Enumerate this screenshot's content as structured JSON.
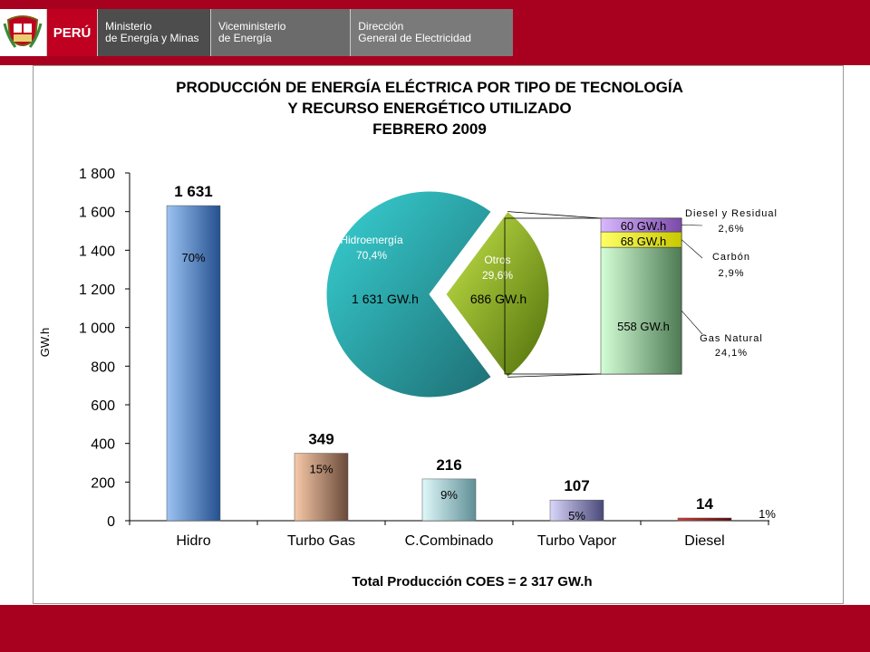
{
  "header": {
    "peru": "PERÚ",
    "ministry_l1": "Ministerio",
    "ministry_l2": "de Energía y Minas",
    "vice_l1": "Viceministerio",
    "vice_l2": "de Energía",
    "dir_l1": "Dirección",
    "dir_l2": "General de Electricidad"
  },
  "colors": {
    "brand": "#a8001f",
    "peru_red": "#c00020"
  },
  "chart_data": [
    {
      "type": "bar",
      "title": [
        "PRODUCCIÓN DE ENERGÍA ELÉCTRICA POR TIPO DE TECNOLOGÍA",
        "Y RECURSO ENERGÉTICO UTILIZADO",
        "FEBRERO 2009"
      ],
      "ylabel": "GW.h",
      "ylim": [
        0,
        1800
      ],
      "yticks": [
        0,
        200,
        400,
        600,
        800,
        1000,
        1200,
        1400,
        1600,
        1800
      ],
      "ytick_labels": [
        "0",
        "200",
        "400",
        "600",
        "800",
        "1 000",
        "1 200",
        "1 400",
        "1 600",
        "1 800"
      ],
      "categories": [
        "Hidro",
        "Turbo Gas",
        "C.Combinado",
        "Turbo Vapor",
        "Diesel"
      ],
      "values": [
        1631,
        349,
        216,
        107,
        14
      ],
      "value_labels": [
        "1 631",
        "349",
        "216",
        "107",
        "14"
      ],
      "percent_labels": [
        "70%",
        "15%",
        "9%",
        "5%",
        "1%"
      ],
      "colors": [
        "#4f86c6",
        "#d9a27b",
        "#a8dfe6",
        "#a9a6dd",
        "#8b1a1a"
      ],
      "footer": "Total Producción COES = 2 317 GW.h"
    },
    {
      "type": "pie",
      "slices": [
        {
          "label": "Hidroenergía",
          "percent_label": "70,4%",
          "value_label": "1 631 GW.h",
          "value": 70.4,
          "color": "#2bb5b8"
        },
        {
          "label": "Otros",
          "percent_label": "29,6%",
          "value_label": "686 GW.h",
          "value": 29.6,
          "color": "#8db51c"
        }
      ],
      "breakdown": [
        {
          "label": "Gas Natural",
          "percent_label": "24,1%",
          "value_label": "558 GW.h",
          "value": 558,
          "color": "#bff0c0"
        },
        {
          "label": "Carbón",
          "percent_label": "2,9%",
          "value_label": "68 GW.h",
          "value": 68,
          "color": "#ffff33"
        },
        {
          "label": "Diesel y Residual",
          "percent_label": "2,6%",
          "value_label": "60 GW.h",
          "value": 60,
          "color": "#c59cf0"
        }
      ]
    }
  ]
}
